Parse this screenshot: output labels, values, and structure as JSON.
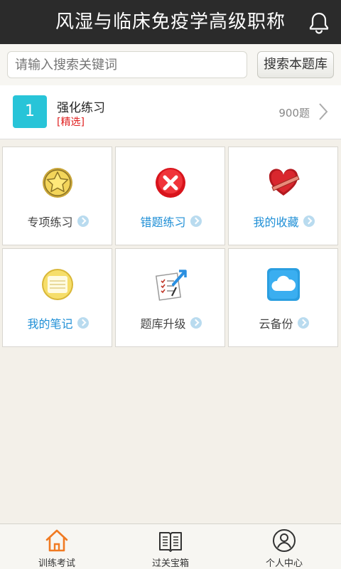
{
  "header": {
    "title": "风湿与临床免疫学高级职称",
    "icon": "bell-icon"
  },
  "search": {
    "placeholder": "请输入搜索关键词",
    "button_label": "搜索本题库"
  },
  "bank": {
    "number": "1",
    "name": "强化练习",
    "tag": "[精选]",
    "count": "900题"
  },
  "grid": [
    {
      "label": "专项练习",
      "icon": "star-badge-icon",
      "style": "dark"
    },
    {
      "label": "错题练习",
      "icon": "error-x-icon",
      "style": "blue"
    },
    {
      "label": "我的收藏",
      "icon": "heart-favorite-icon",
      "style": "blue"
    },
    {
      "label": "我的笔记",
      "icon": "notepad-icon",
      "style": "blue"
    },
    {
      "label": "题库升级",
      "icon": "upgrade-checklist-icon",
      "style": "dark"
    },
    {
      "label": "云备份",
      "icon": "cloud-icon",
      "style": "dark"
    }
  ],
  "tabs": [
    {
      "label": "训练考试",
      "icon": "home-icon",
      "active": true
    },
    {
      "label": "过关宝箱",
      "icon": "book-icon",
      "active": false
    },
    {
      "label": "个人中心",
      "icon": "user-icon",
      "active": false
    }
  ],
  "colors": {
    "accent": "#28c4d8",
    "header": "#2b2b2b",
    "link": "#1f8fd6",
    "tag": "#e02020",
    "active_tab": "#f07a22"
  }
}
